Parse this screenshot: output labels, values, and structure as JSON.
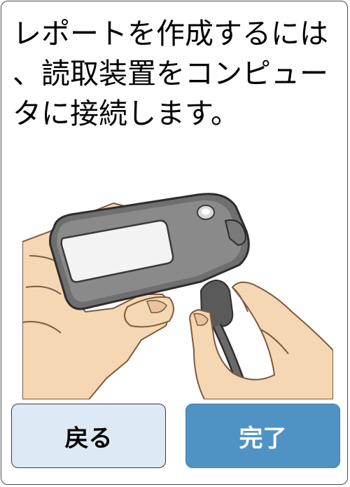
{
  "screen": {
    "message": "レポートを作成するには\n、読取装置をコンピュー\nタに接続します。"
  },
  "illustration": {
    "icon": "reader-connect-to-computer-illustration"
  },
  "buttons": {
    "back_label": "戻る",
    "done_label": "完了"
  },
  "colors": {
    "back_button_bg": "#dde9f4",
    "done_button_bg": "#4f93c4",
    "done_button_text": "#ffffff"
  }
}
